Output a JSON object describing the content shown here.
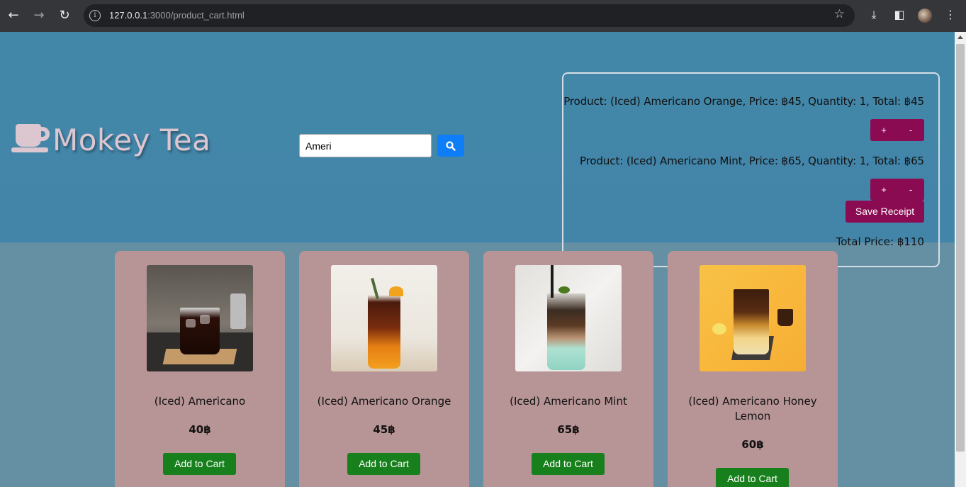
{
  "browser": {
    "url_host": "127.0.0.1",
    "url_path": ":3000/product_cart.html"
  },
  "header": {
    "logo_text": "Mokey Tea",
    "search": {
      "value": "Ameri"
    }
  },
  "cart": {
    "items": [
      {
        "line": "Product: (Iced) Americano Orange, Price: ฿45, Quantity: 1, Total: ฿45",
        "plus": "+",
        "minus": "-"
      },
      {
        "line": "Product: (Iced) Americano Mint, Price: ฿65, Quantity: 1, Total: ฿65",
        "plus": "+",
        "minus": "-"
      }
    ],
    "save_label": "Save Receipt",
    "total_label": "Total Price: ฿110"
  },
  "products": [
    {
      "name": "(Iced) Americano",
      "price": "40฿",
      "button": "Add to Cart"
    },
    {
      "name": "(Iced) Americano Orange",
      "price": "45฿",
      "button": "Add to Cart"
    },
    {
      "name": "(Iced) Americano Mint",
      "price": "65฿",
      "button": "Add to Cart"
    },
    {
      "name": "(Iced) Americano Honey Lemon",
      "price": "60฿",
      "button": "Add to Cart"
    }
  ],
  "colors": {
    "header_bg": "#4286a8",
    "page_bg": "#6590a3",
    "card_bg": "#b79495",
    "accent_button": "#8b0b52",
    "add_button": "#17801c",
    "search_button": "#0d7ef7"
  }
}
